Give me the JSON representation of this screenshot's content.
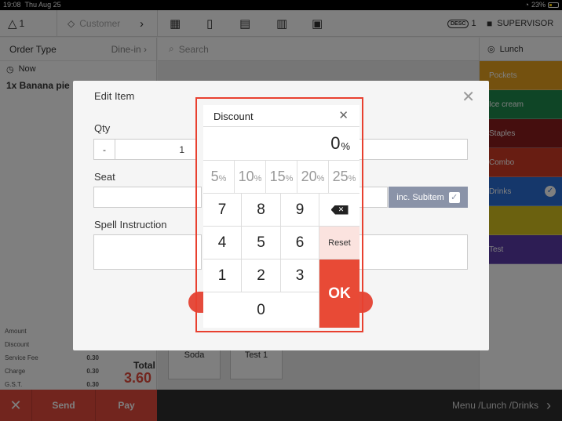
{
  "status": {
    "time": "19:08",
    "date": "Thu Aug 25",
    "battery": "23%"
  },
  "topbar": {
    "guests": "1",
    "customer_placeholder": "Customer",
    "desc_badge": "DESC",
    "desc_count": "1",
    "role": "SUPERVISOR"
  },
  "order": {
    "type_label": "Order Type",
    "type_value": "Dine-in",
    "time_value": "Now",
    "items": [
      "1x Banana pie"
    ]
  },
  "totals": {
    "rows": [
      {
        "label": "Amount",
        "value": ""
      },
      {
        "label": "Discount",
        "value": ""
      },
      {
        "label": "Service Fee",
        "value": "0.30"
      },
      {
        "label": "Charge",
        "value": "0.30"
      },
      {
        "label": "G.S.T.",
        "value": "0.30"
      }
    ],
    "total_label": "Total",
    "total_value": "3.60"
  },
  "search": {
    "placeholder": "Search"
  },
  "tiles": [
    "Soda",
    "Test 1"
  ],
  "categories": {
    "header": "Lunch",
    "items": [
      {
        "label": "Pockets",
        "color": "#e8a21e"
      },
      {
        "label": "Ice cream",
        "color": "#1f8a4c"
      },
      {
        "label": "Staples",
        "color": "#8b1c1c"
      },
      {
        "label": "Combo",
        "color": "#d13a24"
      },
      {
        "label": "Drinks",
        "color": "#2b6fd6"
      },
      {
        "label": "",
        "color": "#d6c21e"
      },
      {
        "label": "Test",
        "color": "#5a3aa8"
      }
    ]
  },
  "bottombar": {
    "send": "Send",
    "pay": "Pay",
    "path": "Menu /Lunch /Drinks"
  },
  "edit_dialog": {
    "title": "Edit Item",
    "qty_label": "Qty",
    "qty_minus": "-",
    "qty_value": "1",
    "seat_label": "Seat",
    "inc_subitem": "inc. Subitem",
    "spell_label": "Spell Instruction"
  },
  "discount": {
    "title": "Discount",
    "value": "0",
    "percent_sign": "%",
    "presets": [
      "5",
      "10",
      "15",
      "20",
      "25"
    ],
    "keys": [
      "7",
      "8",
      "9",
      "4",
      "5",
      "6",
      "1",
      "2",
      "3",
      "0"
    ],
    "reset_label": "Reset",
    "ok_label": "OK"
  },
  "colors": {
    "accent": "#e54b3c",
    "highlight": "#e8402f",
    "subitem": "#8a93a8"
  }
}
